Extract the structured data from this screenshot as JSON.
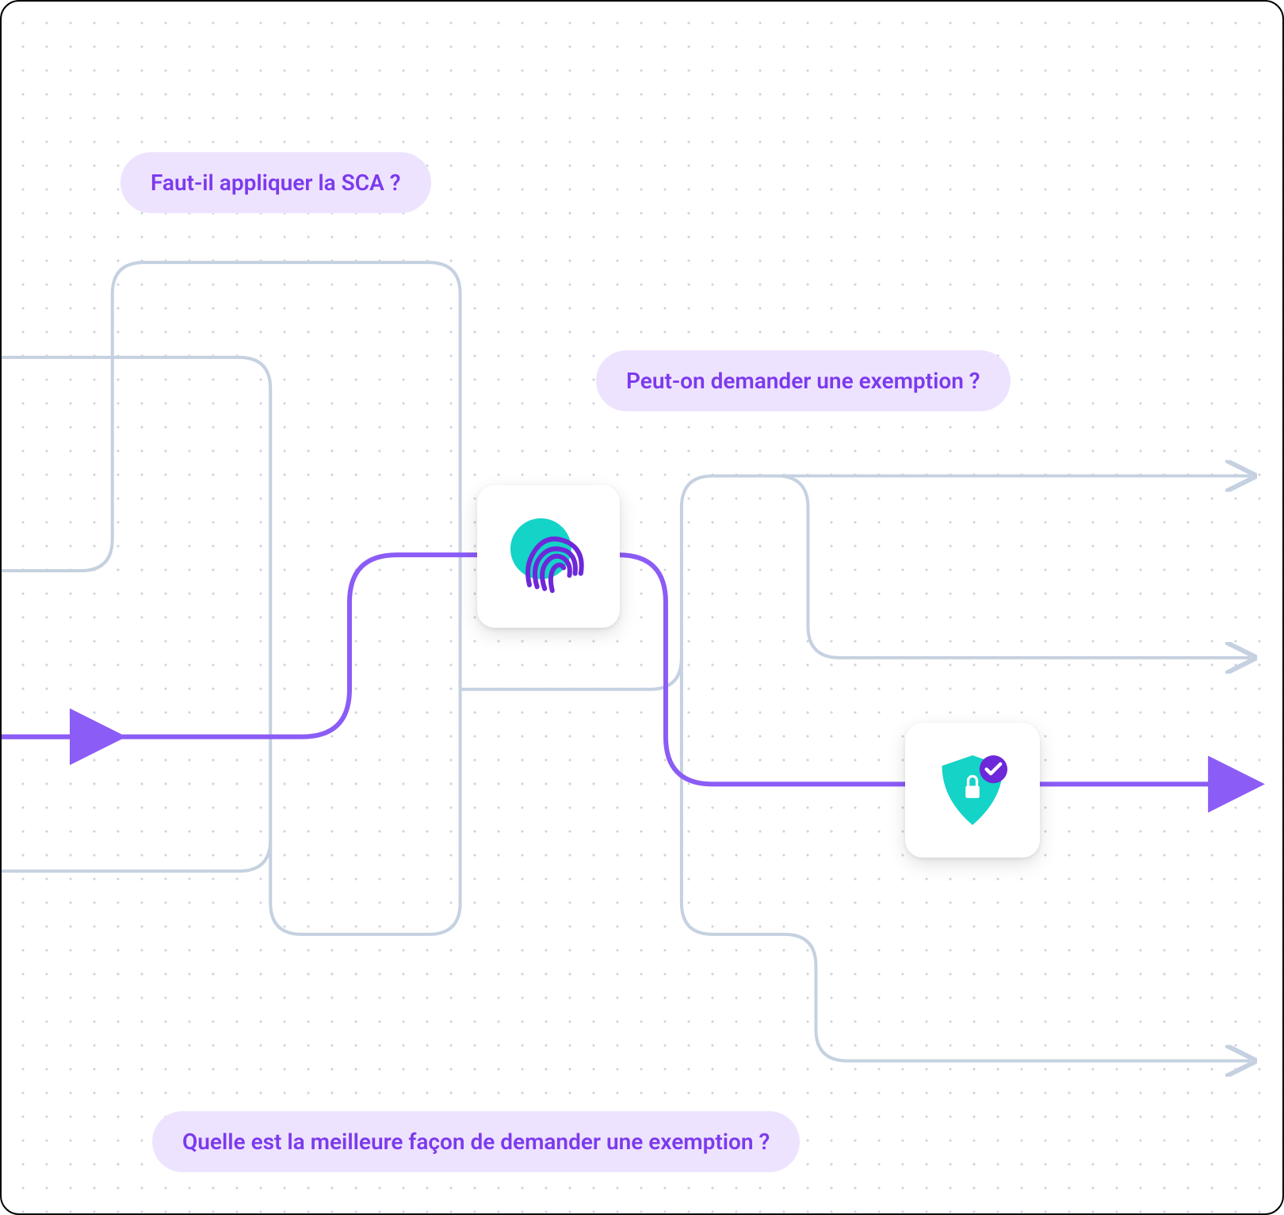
{
  "labels": {
    "q1": "Faut-il appliquer la SCA ?",
    "q2": "Peut-on demander une exemption ?",
    "q3": "Quelle est la meilleure façon de demander une exemption ?"
  },
  "icons": {
    "fingerprint": "fingerprint-icon",
    "shield": "shield-check-icon"
  },
  "colors": {
    "pill_bg": "#eee3ff",
    "pill_text": "#7c3aed",
    "primary_path": "#8b5cf6",
    "secondary_path": "#c5d1e0",
    "accent_teal": "#14d3c7",
    "accent_purple": "#6d28d9"
  }
}
